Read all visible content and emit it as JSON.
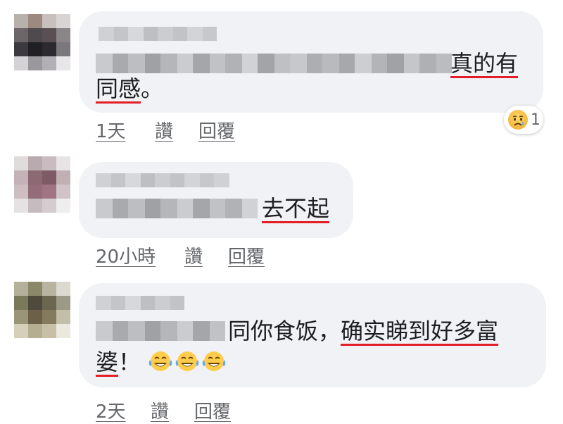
{
  "comments": [
    {
      "text_before": "",
      "text_highlight_1": "真的有",
      "text_highlight_2": "同感",
      "text_after": "。",
      "actions": {
        "time": "1天",
        "like": "讚",
        "reply": "回覆"
      },
      "reaction": {
        "icon": "crying-face-icon",
        "count": "1"
      }
    },
    {
      "text_highlight": "去不起",
      "actions": {
        "time": "20小時",
        "like": "讚",
        "reply": "回覆"
      }
    },
    {
      "text_plain": "同你食饭，",
      "text_highlight_1": "确实睇到好多富",
      "text_highlight_2": "婆",
      "text_after": "！",
      "emojis": [
        "laughing-tears-icon",
        "laughing-tears-icon",
        "laughing-tears-icon"
      ],
      "actions": {
        "time": "2天",
        "like": "讚",
        "reply": "回覆"
      }
    }
  ],
  "colors": {
    "bubble": "#f0f2f5",
    "underline": "#e41e26",
    "meta_text": "#65676b"
  }
}
